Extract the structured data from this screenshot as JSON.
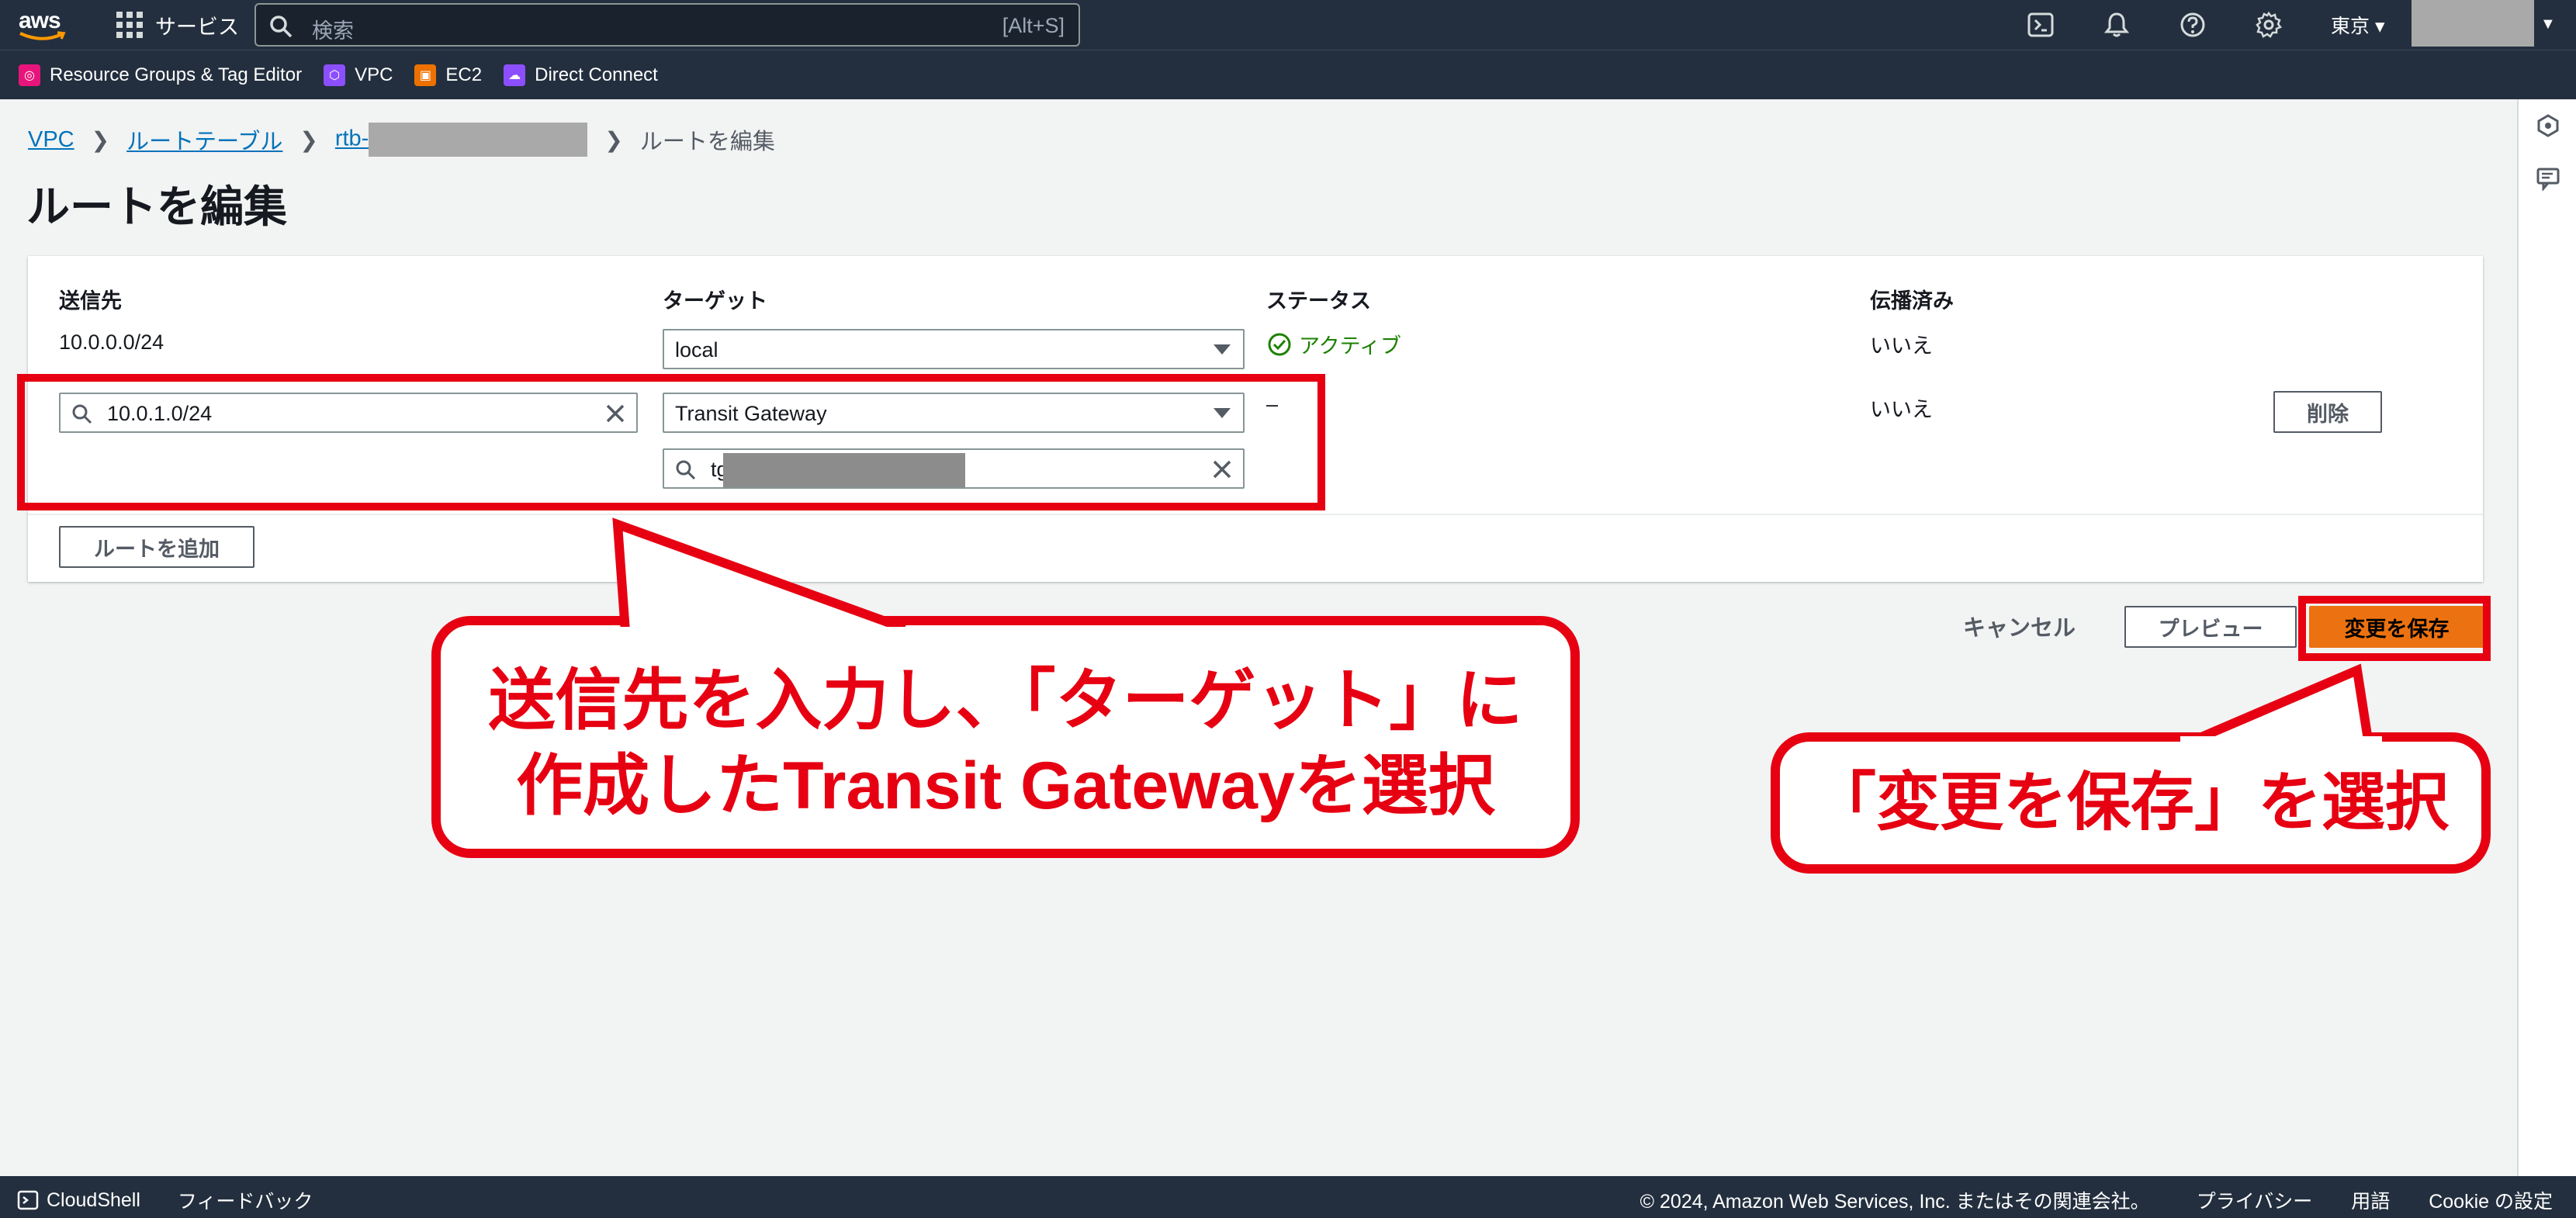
{
  "header": {
    "logo_text": "aws",
    "services_label": "サービス",
    "search_placeholder": "検索",
    "search_shortcut": "[Alt+S]",
    "region": "東京 ▾"
  },
  "favorites": [
    {
      "label": "Resource Groups & Tag Editor",
      "color": "#e7157b"
    },
    {
      "label": "VPC",
      "color": "#8c4fff"
    },
    {
      "label": "EC2",
      "color": "#ed7100"
    },
    {
      "label": "Direct Connect",
      "color": "#8c4fff"
    }
  ],
  "breadcrumb": {
    "vpc": "VPC",
    "route_tables": "ルートテーブル",
    "rtb_prefix": "rtb-",
    "current": "ルートを編集"
  },
  "page_title": "ルートを編集",
  "table": {
    "headers": {
      "destination": "送信先",
      "target": "ターゲット",
      "status": "ステータス",
      "propagated": "伝播済み"
    },
    "row1": {
      "destination": "10.0.0.0/24",
      "target": "local",
      "status": "アクティブ",
      "propagated": "いいえ"
    },
    "row2": {
      "destination": "10.0.1.0/24",
      "target": "Transit Gateway",
      "target_id": "tgw",
      "status": "–",
      "propagated": "いいえ",
      "remove": "削除"
    },
    "add_route": "ルートを追加"
  },
  "actions": {
    "cancel": "キャンセル",
    "preview": "プレビュー",
    "save": "変更を保存"
  },
  "annotations": {
    "callout1_line1": "送信先を入力し、「ターゲット」に",
    "callout1_line2": "作成したTransit Gatewayを選択",
    "callout2": "「変更を保存」を選択",
    "color": "#e60012"
  },
  "footer": {
    "cloudshell": "CloudShell",
    "feedback": "フィードバック",
    "copyright": "© 2024, Amazon Web Services, Inc. またはその関連会社。",
    "privacy": "プライバシー",
    "terms": "用語",
    "cookies": "Cookie の設定"
  },
  "colors": {
    "nav_bg": "#232f3e",
    "primary": "#ec7211",
    "link": "#0073bb",
    "success": "#1d8102"
  }
}
